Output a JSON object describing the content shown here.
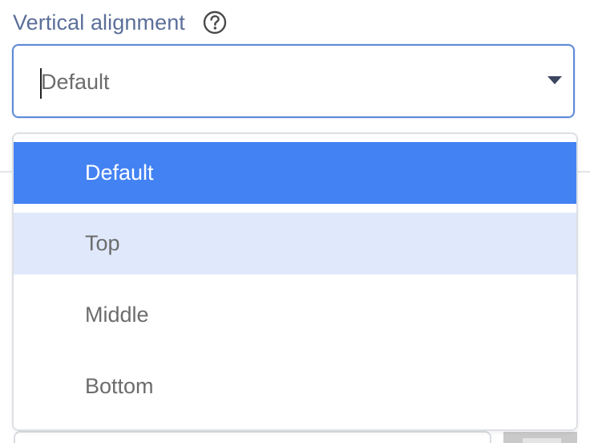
{
  "field": {
    "label": "Vertical alignment",
    "help_icon": "question-circle-icon",
    "selected_value": "Default",
    "dropdown_icon": "triangle-down-icon"
  },
  "menu": {
    "options": [
      {
        "label": "Default",
        "state": "selected"
      },
      {
        "label": "Top",
        "state": "hovered"
      },
      {
        "label": "Middle",
        "state": "normal"
      },
      {
        "label": "Bottom",
        "state": "normal"
      }
    ]
  },
  "colors": {
    "label": "#5b6f9a",
    "focus_border": "#5d8ad8",
    "selected_bg": "#4382f3",
    "hover_bg": "#e0e9fb",
    "text": "#6c6c6c"
  }
}
